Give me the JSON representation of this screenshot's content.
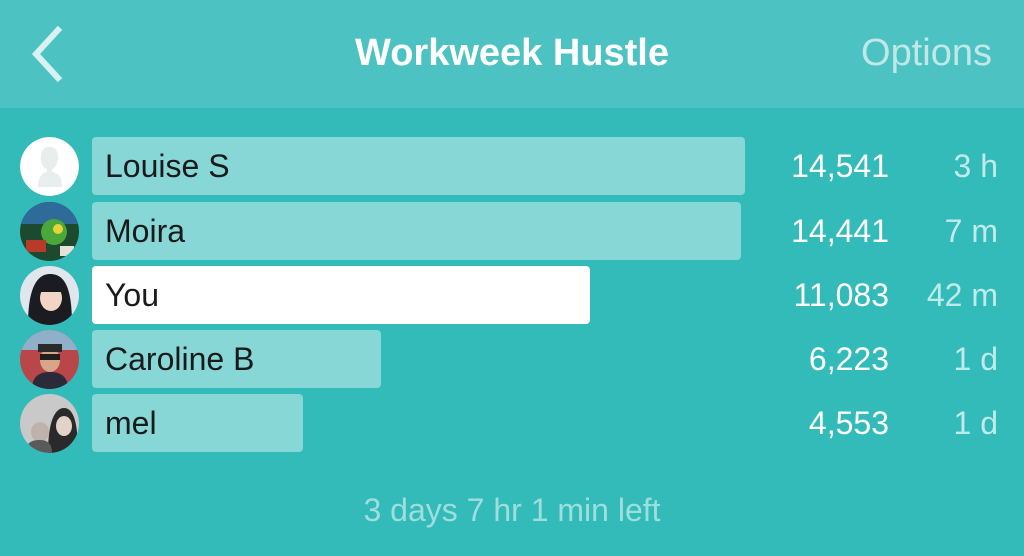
{
  "header": {
    "title": "Workweek Hustle",
    "back_icon": "chevron-left-icon",
    "options_label": "Options"
  },
  "colors": {
    "background": "#33bbba",
    "header": "#4cc3c2",
    "bar": "#87d7d6",
    "bar_self": "#ffffff"
  },
  "leaderboard": [
    {
      "name": "Louise S",
      "steps": "14,541",
      "steps_value": 14541,
      "updated": "3 h",
      "is_self": false
    },
    {
      "name": "Moira",
      "steps": "14,441",
      "steps_value": 14441,
      "updated": "7 m",
      "is_self": false
    },
    {
      "name": "You",
      "steps": "11,083",
      "steps_value": 11083,
      "updated": "42 m",
      "is_self": true
    },
    {
      "name": "Caroline B",
      "steps": "6,223",
      "steps_value": 6223,
      "updated": "1 d",
      "is_self": false
    },
    {
      "name": "mel",
      "steps": "4,553",
      "steps_value": 4553,
      "updated": "1 d",
      "is_self": false
    }
  ],
  "footer": {
    "time_left": "3 days 7 hr 1 min left"
  }
}
